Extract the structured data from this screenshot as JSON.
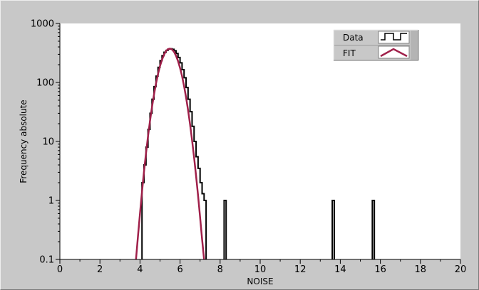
{
  "chart_data": {
    "type": "line",
    "xlabel": "NOISE",
    "ylabel": "Frequency absolute",
    "xlim": [
      0,
      20
    ],
    "ylim": [
      0.1,
      1000
    ],
    "yscale": "log",
    "grid": false,
    "legend_position": "top-right",
    "x_ticks": [
      "0",
      "2",
      "4",
      "6",
      "8",
      "10",
      "12",
      "14",
      "16",
      "18",
      "20"
    ],
    "y_ticks": [
      "0.1",
      "1",
      "10",
      "100",
      "1000"
    ],
    "series": [
      {
        "name": "Data",
        "style": "step",
        "color": "#000000",
        "bin_width": 0.1,
        "bins": [
          [
            4.1,
            2
          ],
          [
            4.2,
            4
          ],
          [
            4.3,
            8
          ],
          [
            4.4,
            16
          ],
          [
            4.5,
            30
          ],
          [
            4.6,
            52
          ],
          [
            4.7,
            85
          ],
          [
            4.8,
            128
          ],
          [
            4.9,
            180
          ],
          [
            5.0,
            235
          ],
          [
            5.1,
            285
          ],
          [
            5.2,
            325
          ],
          [
            5.3,
            350
          ],
          [
            5.4,
            368
          ],
          [
            5.5,
            372
          ],
          [
            5.6,
            365
          ],
          [
            5.7,
            345
          ],
          [
            5.8,
            310
          ],
          [
            5.9,
            265
          ],
          [
            6.0,
            215
          ],
          [
            6.1,
            165
          ],
          [
            6.2,
            120
          ],
          [
            6.3,
            82
          ],
          [
            6.4,
            52
          ],
          [
            6.5,
            32
          ],
          [
            6.6,
            18
          ],
          [
            6.7,
            10
          ],
          [
            6.8,
            5.5
          ],
          [
            6.9,
            3.5
          ],
          [
            7.0,
            2
          ],
          [
            7.1,
            1.3
          ],
          [
            7.2,
            1
          ],
          [
            8.2,
            1
          ],
          [
            13.6,
            1
          ],
          [
            15.6,
            1
          ]
        ]
      },
      {
        "name": "FIT",
        "style": "line",
        "color": "#a0204a",
        "x": [
          3.8,
          3.9,
          4.0,
          4.1,
          4.2,
          4.3,
          4.4,
          4.5,
          4.6,
          4.7,
          4.8,
          4.9,
          5.0,
          5.1,
          5.2,
          5.3,
          5.4,
          5.5,
          5.6,
          5.7,
          5.8,
          5.9,
          6.0,
          6.1,
          6.2,
          6.3,
          6.4,
          6.5,
          6.6,
          6.7,
          6.8,
          6.9,
          7.0,
          7.1,
          7.2,
          7.3,
          7.4
        ],
        "y": [
          0.1,
          0.25,
          0.6,
          1.4,
          3.1,
          6.3,
          12.2,
          22.3,
          38.5,
          62.7,
          96.2,
          139,
          190,
          244,
          296,
          340,
          368,
          375,
          362,
          330,
          283,
          230,
          176,
          128,
          87,
          56,
          34,
          19.5,
          10.5,
          5.4,
          2.6,
          1.2,
          0.52,
          0.22,
          0.1,
          0.05,
          0.02
        ]
      }
    ]
  }
}
